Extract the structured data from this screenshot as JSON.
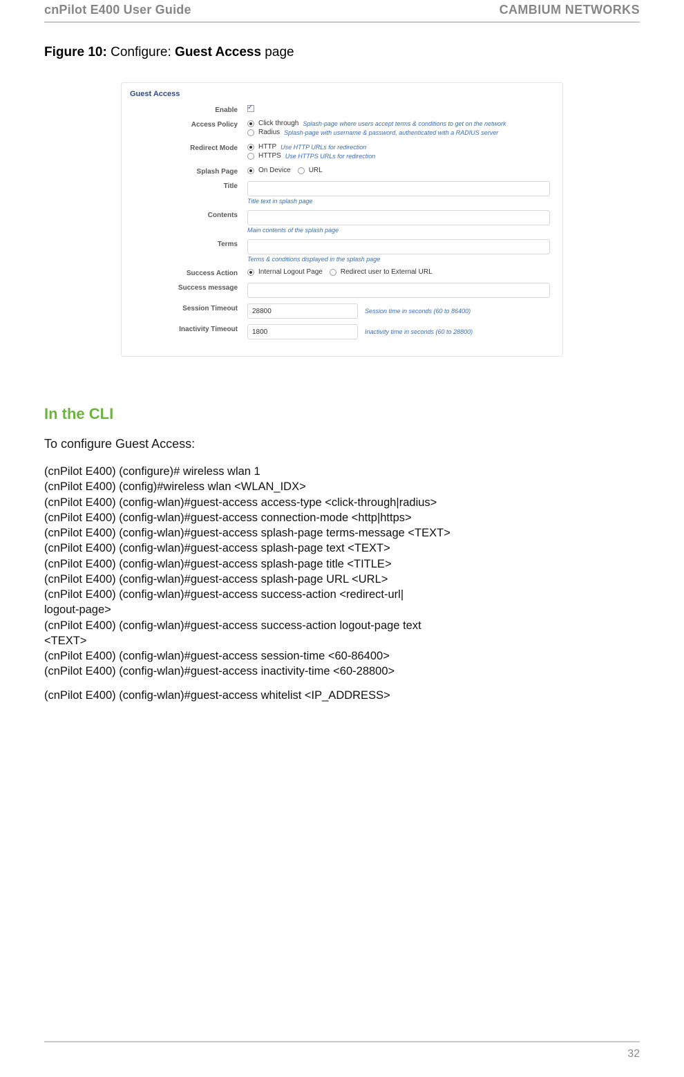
{
  "header": {
    "left": "cnPilot E400 User Guide",
    "right": "CAMBIUM NETWORKS"
  },
  "figure": {
    "prefix": "Figure 10:",
    "mid": " Configure: ",
    "bold2": "Guest Access",
    "suffix": " page"
  },
  "shot": {
    "panel_title": "Guest Access",
    "rows": {
      "enable": {
        "label": "Enable"
      },
      "access_policy": {
        "label": "Access Policy",
        "opt1": "Click through",
        "opt1_hint": "Splash-page where users accept terms & conditions to get on the network",
        "opt2": "Radius",
        "opt2_hint": "Splash-page with username & password, authenticated with a RADIUS server"
      },
      "redirect_mode": {
        "label": "Redirect Mode",
        "opt1": "HTTP",
        "opt1_hint": "Use HTTP URLs for redirection",
        "opt2": "HTTPS",
        "opt2_hint": "Use HTTPS URLs for redirection"
      },
      "splash_page": {
        "label": "Splash Page",
        "opt1": "On Device",
        "opt2": "URL"
      },
      "title_row": {
        "label": "Title",
        "hint": "Title text in splash page",
        "value": ""
      },
      "contents": {
        "label": "Contents",
        "hint": "Main contents of the splash page",
        "value": ""
      },
      "terms": {
        "label": "Terms",
        "hint": "Terms & conditions displayed in the splash page",
        "value": ""
      },
      "success_action": {
        "label": "Success Action",
        "opt1": "Internal Logout Page",
        "opt2": "Redirect user to External URL"
      },
      "success_message": {
        "label": "Success message",
        "value": ""
      },
      "session_timeout": {
        "label": "Session Timeout",
        "value": "28800",
        "hint": "Session time in seconds (60 to 86400)"
      },
      "inactivity_timeout": {
        "label": "Inactivity Timeout",
        "value": "1800",
        "hint": "Inactivity time in seconds (60 to 28800)"
      }
    }
  },
  "cli": {
    "heading": "In the CLI",
    "sub": "To configure Guest Access:",
    "block1": "(cnPilot E400) (configure)# wireless wlan 1\n(cnPilot E400) (config)#wireless wlan <WLAN_IDX>\n(cnPilot E400) (config-wlan)#guest-access access-type <click-through|radius>\n(cnPilot E400) (config-wlan)#guest-access connection-mode <http|https>\n(cnPilot E400) (config-wlan)#guest-access splash-page terms-message <TEXT>\n(cnPilot E400) (config-wlan)#guest-access splash-page text <TEXT>\n(cnPilot E400) (config-wlan)#guest-access splash-page title <TITLE>\n(cnPilot E400) (config-wlan)#guest-access splash-page URL <URL>\n(cnPilot E400) (config-wlan)#guest-access success-action <redirect-url|\nlogout-page>\n(cnPilot E400) (config-wlan)#guest-access success-action logout-page text\n<TEXT>\n(cnPilot E400) (config-wlan)#guest-access session-time <60-86400>\n(cnPilot E400) (config-wlan)#guest-access inactivity-time <60-28800>",
    "block2": "(cnPilot E400) (config-wlan)#guest-access whitelist <IP_ADDRESS>"
  },
  "footer": {
    "page_number": "32"
  }
}
